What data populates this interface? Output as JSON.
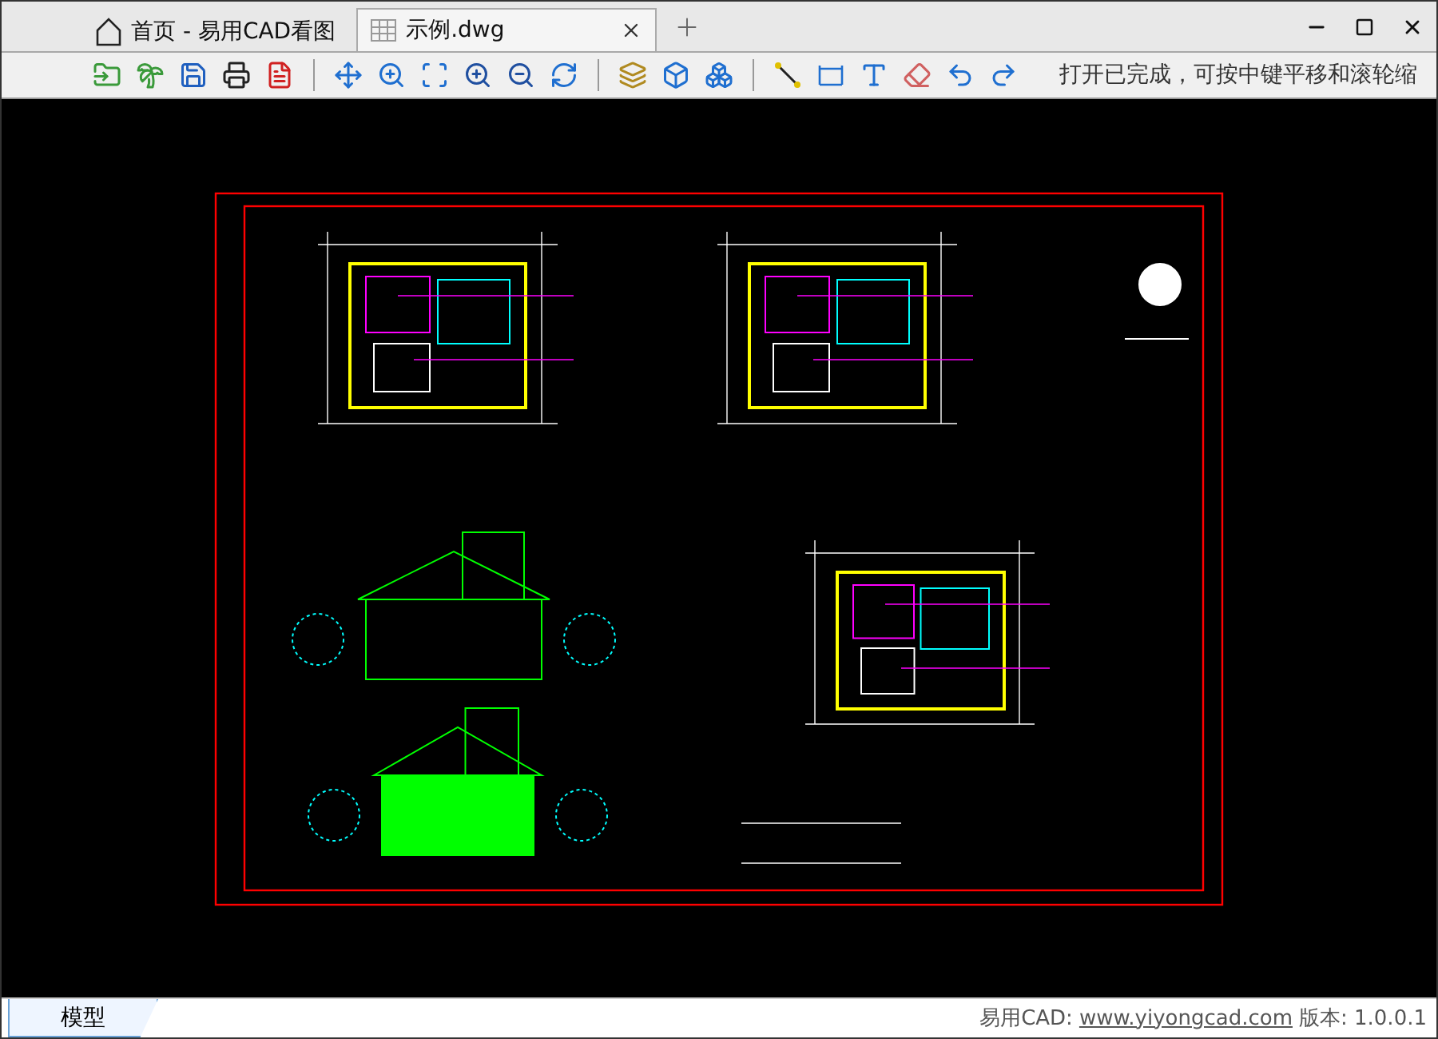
{
  "tabs": [
    {
      "label": "首页 - 易用CAD看图",
      "kind": "home",
      "selected": false
    },
    {
      "label": "示例.dwg",
      "kind": "file",
      "selected": true
    }
  ],
  "toolbar_message": "打开已完成，可按中键平移和滚轮缩",
  "layout_tabs": [
    {
      "label": "模型",
      "selected": true
    }
  ],
  "footer": {
    "product": "易用CAD:",
    "link": "www.yiyongcad.com",
    "version": "版本: 1.0.0.1"
  }
}
